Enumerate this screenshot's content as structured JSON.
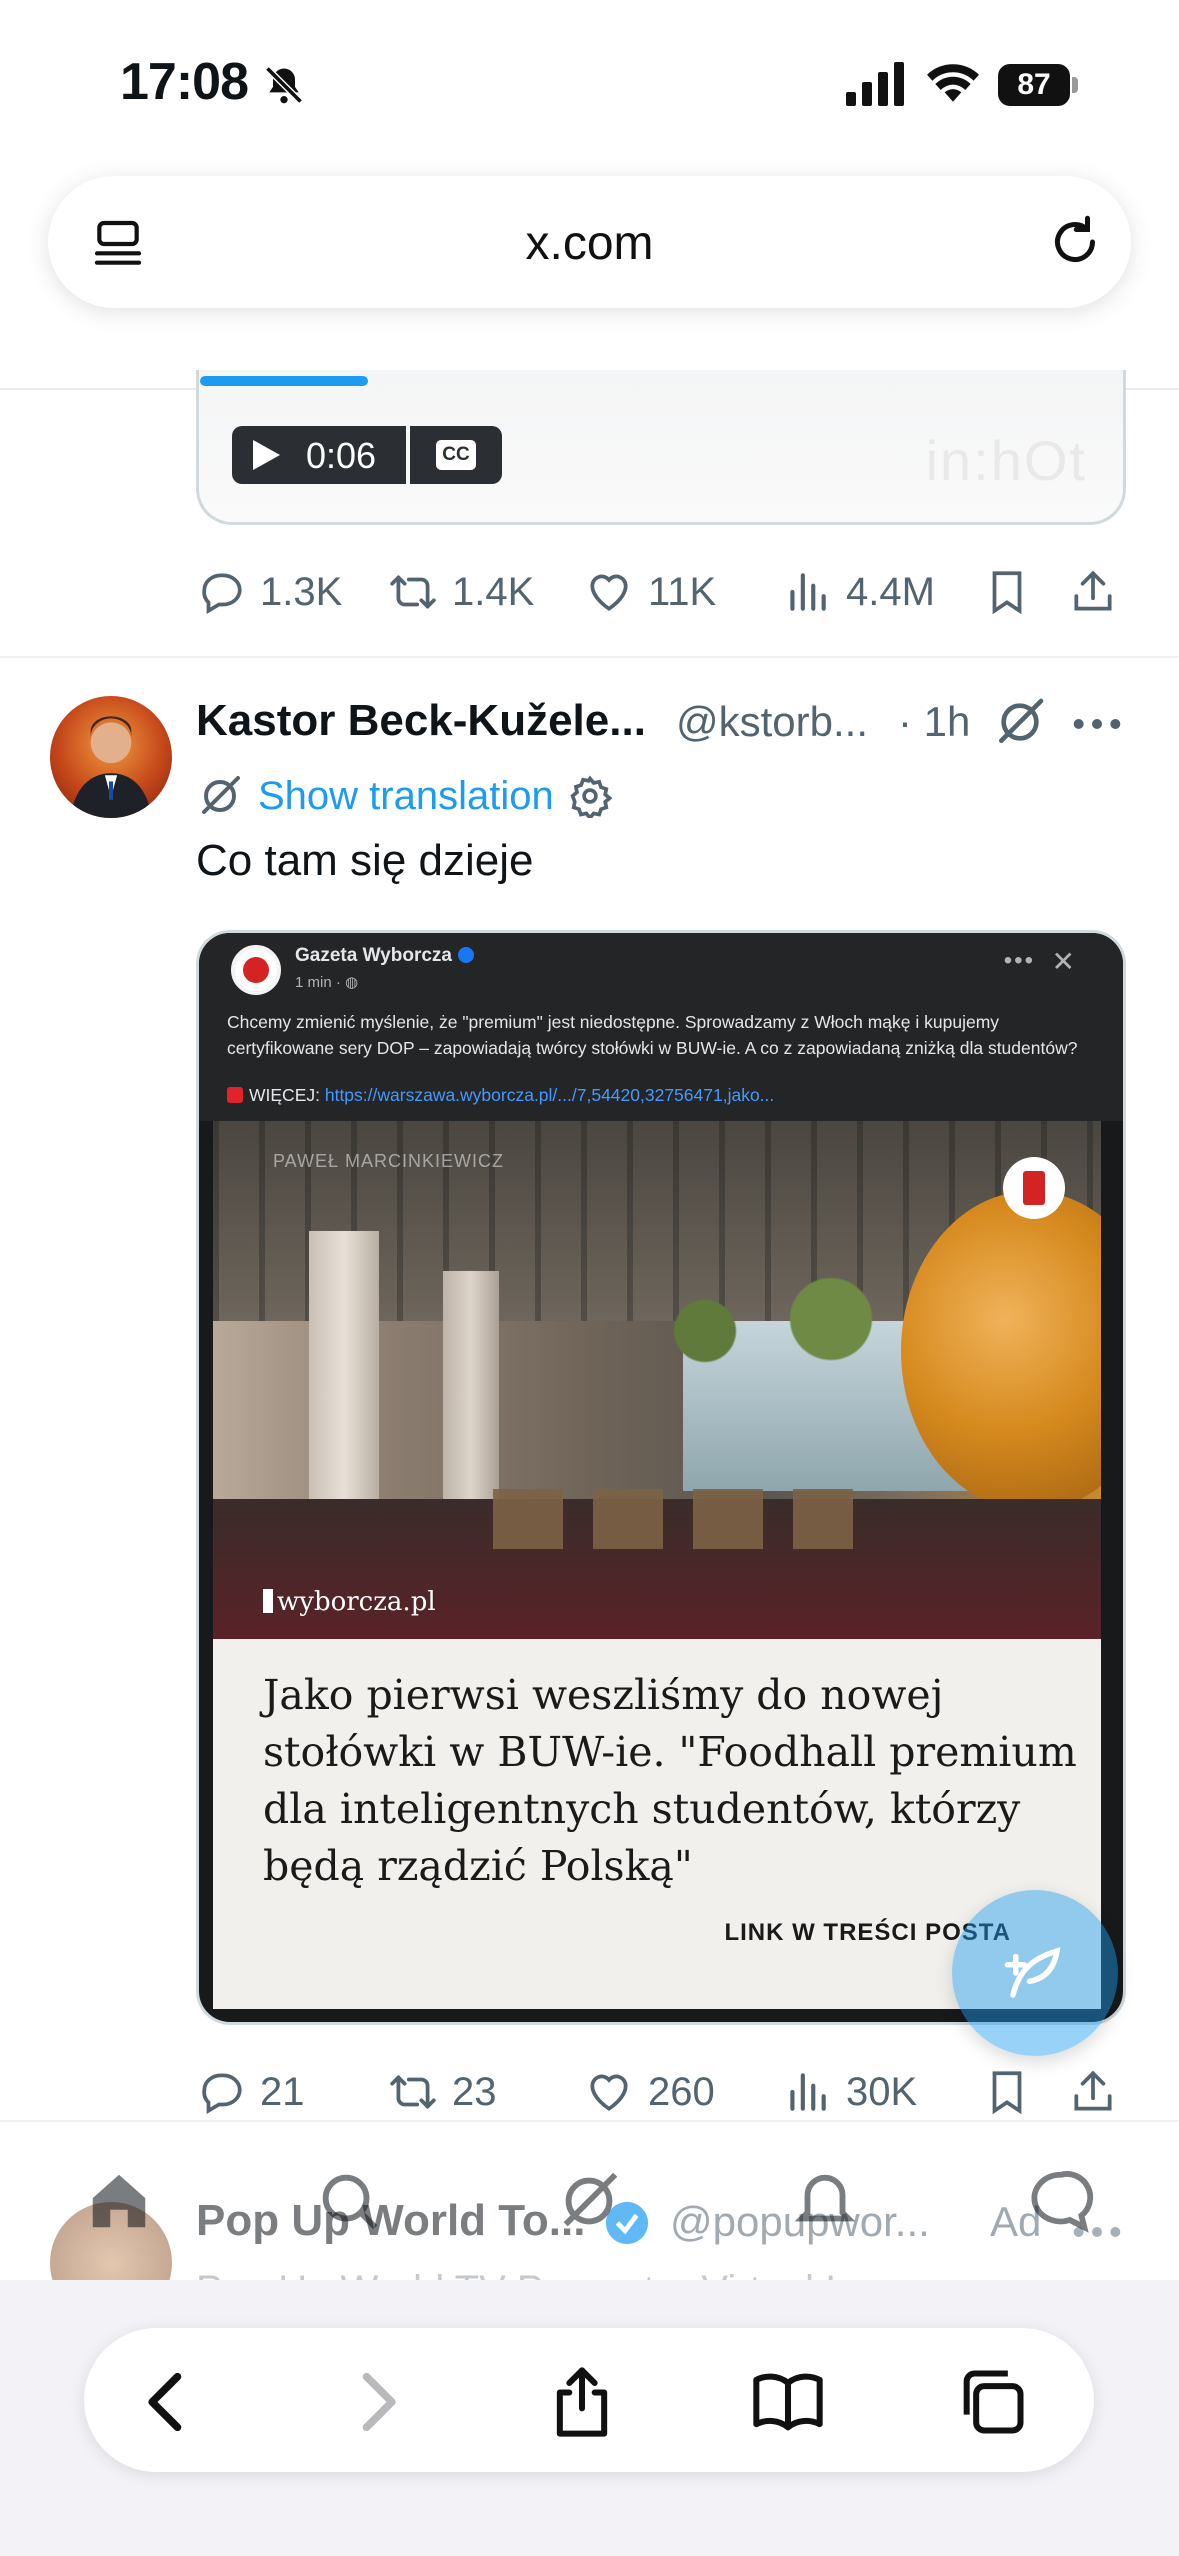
{
  "status_bar": {
    "time": "17:08",
    "battery": "87"
  },
  "browser": {
    "url": "x.com"
  },
  "previous_tweet": {
    "video": {
      "time": "0:06",
      "cc": "CC",
      "watermark": "in:hOt"
    },
    "actions": {
      "replies": "1.3K",
      "reposts": "1.4K",
      "likes": "11K",
      "views": "4.4M"
    }
  },
  "tweet": {
    "author_name": "Kastor Beck-Kužele...",
    "handle": "@kstorb...",
    "time": "· 1h",
    "translate_label": "Show translation",
    "text": "Co tam się dzieje",
    "embed": {
      "source_name": "Gazeta Wyborcza",
      "source_meta": "1 min · ",
      "body": "Chcemy zmienić myślenie, że \"premium\" jest niedostępne. Sprowadzamy z Włoch mąkę i kupujemy certyfikowane sery DOP – zapowiadają twórcy stołówki w BUW-ie. A co z zapowiadaną zniżką dla studentów?",
      "more_prefix": "WIĘCEJ: ",
      "more_link": "https://warszawa.wyborcza.pl/.../7,54420,32756471,jako...",
      "photo_credit": "PAWEŁ MARCINKIEWICZ",
      "photo_brand": "wyborcza.pl",
      "headline": "Jako pierwsi weszliśmy do nowej stołówki w BUW-ie. \"Foodhall premium dla inteligentnych studentów, którzy będą rządzić Polską\"",
      "cta": "LINK W TREŚCI POSTA"
    },
    "actions": {
      "replies": "21",
      "reposts": "23",
      "likes": "260",
      "views": "30K"
    }
  },
  "next_tweet": {
    "author_name": "Pop Up World To...",
    "handle": "@popupwor...",
    "ad_label": "Ad",
    "preview": "Pop Up World TV Presenter Virtual I..."
  },
  "colors": {
    "accent": "#1d9bf0",
    "muted": "#536471",
    "text": "#0f1419"
  },
  "icons": [
    "bell-off-icon",
    "signal-icon",
    "wifi-icon",
    "battery-icon",
    "reader-icon",
    "reload-icon",
    "reply-icon",
    "repost-icon",
    "like-icon",
    "views-icon",
    "bookmark-icon",
    "share-icon",
    "grok-icon",
    "more-icon",
    "translate-icon",
    "gear-icon",
    "compose-icon",
    "home-icon",
    "search-icon",
    "notifications-icon",
    "messages-icon",
    "back-icon",
    "forward-icon",
    "share-sheet-icon",
    "bookmarks-icon",
    "tabs-icon"
  ]
}
